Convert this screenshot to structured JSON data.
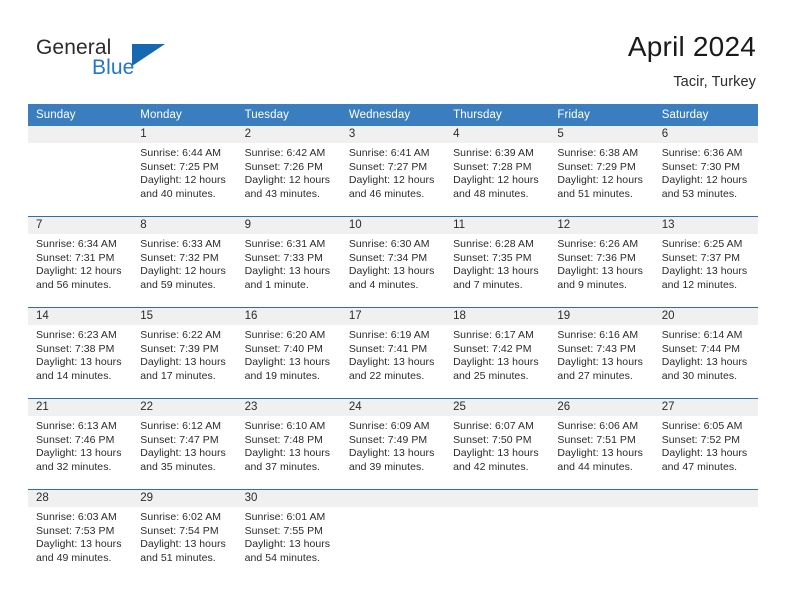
{
  "logo": {
    "word_top": "General",
    "word_bottom": "Blue",
    "triangle_color": "#1668b3"
  },
  "header": {
    "title": "April 2024",
    "location": "Tacir, Turkey"
  },
  "theme": {
    "header_blue": "#3a7ebf",
    "row_divider_blue": "#2a6fb0",
    "daynum_band": "#f0f0f0",
    "text": "#2b2b2b"
  },
  "weekday_headers": [
    "Sunday",
    "Monday",
    "Tuesday",
    "Wednesday",
    "Thursday",
    "Friday",
    "Saturday"
  ],
  "weeks": [
    [
      {
        "day": "",
        "info": "",
        "state": "empty"
      },
      {
        "day": "1",
        "info": "Sunrise: 6:44 AM\nSunset: 7:25 PM\nDaylight: 12 hours\nand 40 minutes.",
        "state": "filled"
      },
      {
        "day": "2",
        "info": "Sunrise: 6:42 AM\nSunset: 7:26 PM\nDaylight: 12 hours\nand 43 minutes.",
        "state": "filled"
      },
      {
        "day": "3",
        "info": "Sunrise: 6:41 AM\nSunset: 7:27 PM\nDaylight: 12 hours\nand 46 minutes.",
        "state": "filled"
      },
      {
        "day": "4",
        "info": "Sunrise: 6:39 AM\nSunset: 7:28 PM\nDaylight: 12 hours\nand 48 minutes.",
        "state": "filled"
      },
      {
        "day": "5",
        "info": "Sunrise: 6:38 AM\nSunset: 7:29 PM\nDaylight: 12 hours\nand 51 minutes.",
        "state": "filled"
      },
      {
        "day": "6",
        "info": "Sunrise: 6:36 AM\nSunset: 7:30 PM\nDaylight: 12 hours\nand 53 minutes.",
        "state": "filled"
      }
    ],
    [
      {
        "day": "7",
        "info": "Sunrise: 6:34 AM\nSunset: 7:31 PM\nDaylight: 12 hours\nand 56 minutes.",
        "state": "filled"
      },
      {
        "day": "8",
        "info": "Sunrise: 6:33 AM\nSunset: 7:32 PM\nDaylight: 12 hours\nand 59 minutes.",
        "state": "filled"
      },
      {
        "day": "9",
        "info": "Sunrise: 6:31 AM\nSunset: 7:33 PM\nDaylight: 13 hours\nand 1 minute.",
        "state": "filled"
      },
      {
        "day": "10",
        "info": "Sunrise: 6:30 AM\nSunset: 7:34 PM\nDaylight: 13 hours\nand 4 minutes.",
        "state": "filled"
      },
      {
        "day": "11",
        "info": "Sunrise: 6:28 AM\nSunset: 7:35 PM\nDaylight: 13 hours\nand 7 minutes.",
        "state": "filled"
      },
      {
        "day": "12",
        "info": "Sunrise: 6:26 AM\nSunset: 7:36 PM\nDaylight: 13 hours\nand 9 minutes.",
        "state": "filled"
      },
      {
        "day": "13",
        "info": "Sunrise: 6:25 AM\nSunset: 7:37 PM\nDaylight: 13 hours\nand 12 minutes.",
        "state": "filled"
      }
    ],
    [
      {
        "day": "14",
        "info": "Sunrise: 6:23 AM\nSunset: 7:38 PM\nDaylight: 13 hours\nand 14 minutes.",
        "state": "filled"
      },
      {
        "day": "15",
        "info": "Sunrise: 6:22 AM\nSunset: 7:39 PM\nDaylight: 13 hours\nand 17 minutes.",
        "state": "filled"
      },
      {
        "day": "16",
        "info": "Sunrise: 6:20 AM\nSunset: 7:40 PM\nDaylight: 13 hours\nand 19 minutes.",
        "state": "filled"
      },
      {
        "day": "17",
        "info": "Sunrise: 6:19 AM\nSunset: 7:41 PM\nDaylight: 13 hours\nand 22 minutes.",
        "state": "filled"
      },
      {
        "day": "18",
        "info": "Sunrise: 6:17 AM\nSunset: 7:42 PM\nDaylight: 13 hours\nand 25 minutes.",
        "state": "filled"
      },
      {
        "day": "19",
        "info": "Sunrise: 6:16 AM\nSunset: 7:43 PM\nDaylight: 13 hours\nand 27 minutes.",
        "state": "filled"
      },
      {
        "day": "20",
        "info": "Sunrise: 6:14 AM\nSunset: 7:44 PM\nDaylight: 13 hours\nand 30 minutes.",
        "state": "filled"
      }
    ],
    [
      {
        "day": "21",
        "info": "Sunrise: 6:13 AM\nSunset: 7:46 PM\nDaylight: 13 hours\nand 32 minutes.",
        "state": "filled"
      },
      {
        "day": "22",
        "info": "Sunrise: 6:12 AM\nSunset: 7:47 PM\nDaylight: 13 hours\nand 35 minutes.",
        "state": "filled"
      },
      {
        "day": "23",
        "info": "Sunrise: 6:10 AM\nSunset: 7:48 PM\nDaylight: 13 hours\nand 37 minutes.",
        "state": "filled"
      },
      {
        "day": "24",
        "info": "Sunrise: 6:09 AM\nSunset: 7:49 PM\nDaylight: 13 hours\nand 39 minutes.",
        "state": "filled"
      },
      {
        "day": "25",
        "info": "Sunrise: 6:07 AM\nSunset: 7:50 PM\nDaylight: 13 hours\nand 42 minutes.",
        "state": "filled"
      },
      {
        "day": "26",
        "info": "Sunrise: 6:06 AM\nSunset: 7:51 PM\nDaylight: 13 hours\nand 44 minutes.",
        "state": "filled"
      },
      {
        "day": "27",
        "info": "Sunrise: 6:05 AM\nSunset: 7:52 PM\nDaylight: 13 hours\nand 47 minutes.",
        "state": "filled"
      }
    ],
    [
      {
        "day": "28",
        "info": "Sunrise: 6:03 AM\nSunset: 7:53 PM\nDaylight: 13 hours\nand 49 minutes.",
        "state": "filled"
      },
      {
        "day": "29",
        "info": "Sunrise: 6:02 AM\nSunset: 7:54 PM\nDaylight: 13 hours\nand 51 minutes.",
        "state": "filled"
      },
      {
        "day": "30",
        "info": "Sunrise: 6:01 AM\nSunset: 7:55 PM\nDaylight: 13 hours\nand 54 minutes.",
        "state": "filled"
      },
      {
        "day": "",
        "info": "",
        "state": "empty"
      },
      {
        "day": "",
        "info": "",
        "state": "empty"
      },
      {
        "day": "",
        "info": "",
        "state": "empty"
      },
      {
        "day": "",
        "info": "",
        "state": "empty"
      }
    ]
  ]
}
